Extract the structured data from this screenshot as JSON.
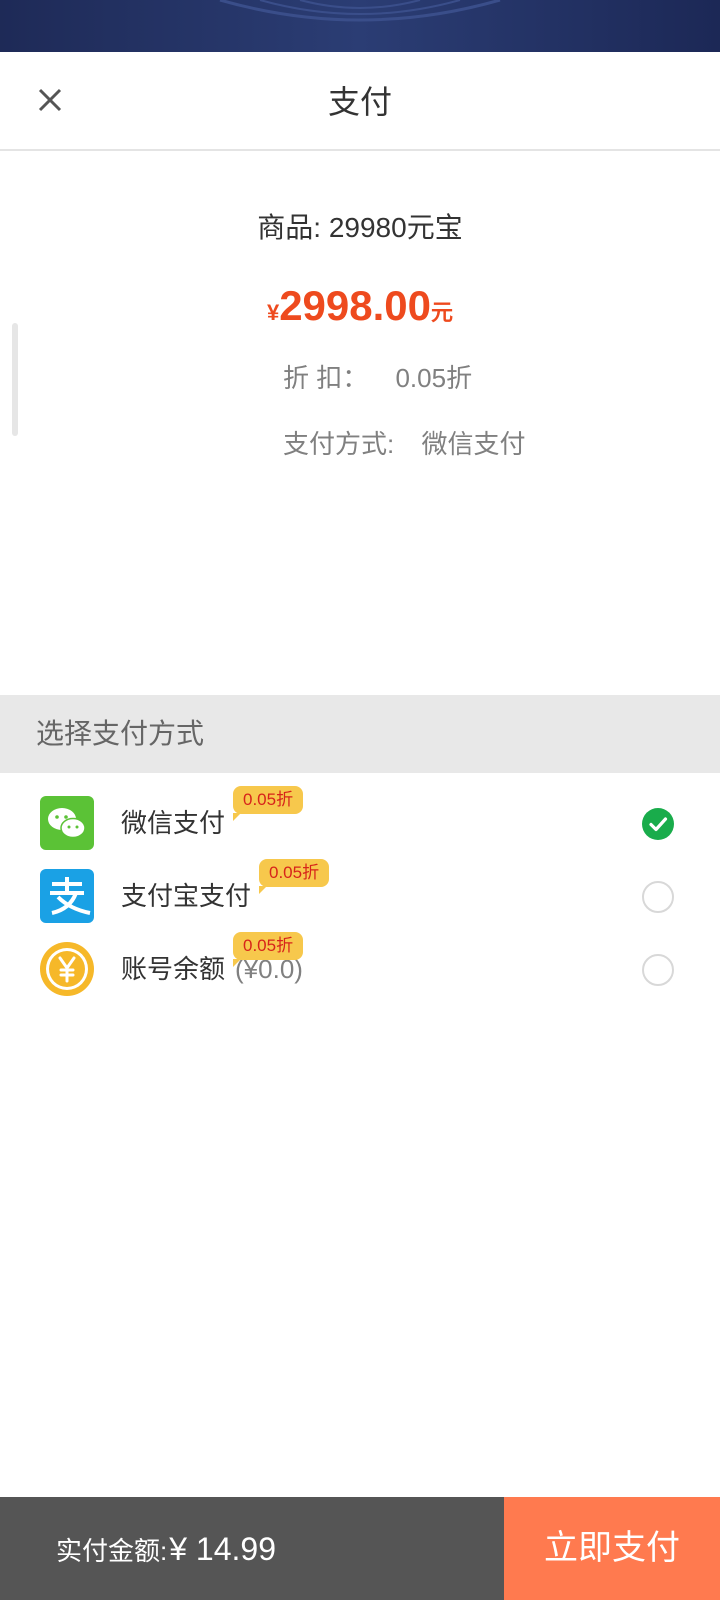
{
  "header": {
    "title": "支付"
  },
  "order": {
    "product_label": "商品:",
    "product_value": "29980元宝",
    "currency_symbol": "¥",
    "price": "2998.00",
    "price_unit": "元",
    "discount_label": "折 扣：",
    "discount_value": "0.05折",
    "method_label": "支付方式:",
    "method_value": "微信支付"
  },
  "section": {
    "title": "选择支付方式"
  },
  "payment_methods": [
    {
      "label": "微信支付",
      "tag": "0.05折",
      "selected": true,
      "icon": "wechat-icon"
    },
    {
      "label": "支付宝支付",
      "tag": "0.05折",
      "selected": false,
      "icon": "alipay-icon"
    },
    {
      "label": "账号余额",
      "balance": "(¥0.0)",
      "tag": "0.05折",
      "selected": false,
      "icon": "coin-icon"
    }
  ],
  "footer": {
    "total_label": "实付金额:",
    "total_value": "¥ 14.99",
    "pay_button": "立即支付"
  },
  "colors": {
    "accent": "#ee4a1e",
    "pay_button": "#ff7a4f",
    "footer_bg": "#555555",
    "tag_bg": "#f7c84c",
    "check_green": "#19ac4b"
  }
}
